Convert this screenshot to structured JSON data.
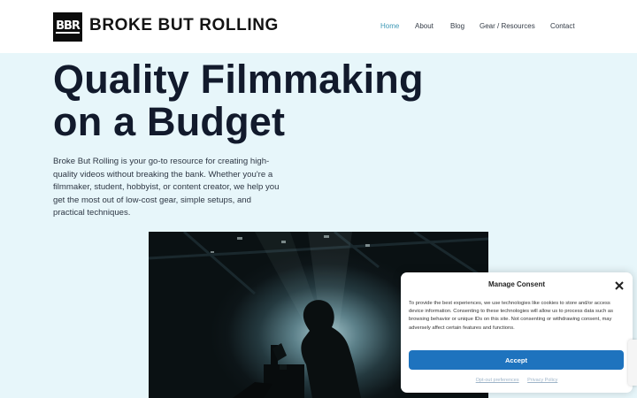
{
  "header": {
    "logo_text": "BBR",
    "site_title": "BROKE BUT ROLLING",
    "nav": [
      {
        "label": "Home"
      },
      {
        "label": "About"
      },
      {
        "label": "Blog"
      },
      {
        "label": "Gear / Resources"
      },
      {
        "label": "Contact"
      }
    ],
    "active_color": "#3f99b6"
  },
  "hero": {
    "title_line1": "Quality Filmmaking",
    "title_line2": "on a Budget",
    "description": "Broke But Rolling is your go-to resource for creating high-quality videos without breaking the bank. Whether you're a filmmaker, student, hobbyist, or content creator, we help you get the most out of low-cost gear, simple setups, and practical techniques."
  },
  "consent": {
    "title": "Manage Consent",
    "body": "To provide the best experiences, we use technologies like cookies to store and/or access device information. Consenting to these technologies will allow us to process data such as browsing behavior or unique IDs on this site. Not consenting or withdrawing consent, may adversely affect certain features and functions.",
    "accept_label": "Accept",
    "links": {
      "opt_out": "Opt-out preferences",
      "privacy": "Privacy Policy"
    },
    "accent": "#1e73be"
  }
}
